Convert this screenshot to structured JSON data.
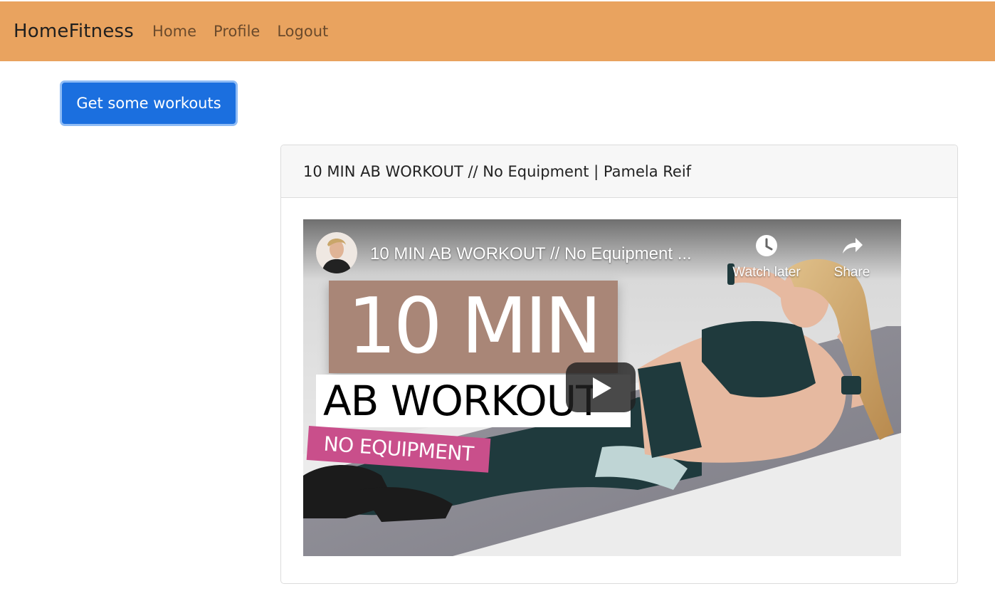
{
  "navbar": {
    "brand": "HomeFitness",
    "links": [
      "Home",
      "Profile",
      "Logout"
    ],
    "background": "#e9a35f"
  },
  "actions": {
    "get_workouts_label": "Get some workouts",
    "button_color": "#1b6fdf"
  },
  "workout_card": {
    "title": "10 MIN AB WORKOUT // No Equipment | Pamela Reif",
    "video": {
      "title": "10 MIN AB WORKOUT // No Equipment ...",
      "watch_later_label": "Watch later",
      "share_label": "Share",
      "thumbnail": {
        "line1": "10 MIN",
        "line2": "AB WORKOUT",
        "line3": "NO EQUIPMENT"
      },
      "icons": {
        "watch_later": "clock-icon",
        "share": "share-arrow-icon",
        "play": "play-icon",
        "avatar": "channel-avatar"
      }
    }
  }
}
